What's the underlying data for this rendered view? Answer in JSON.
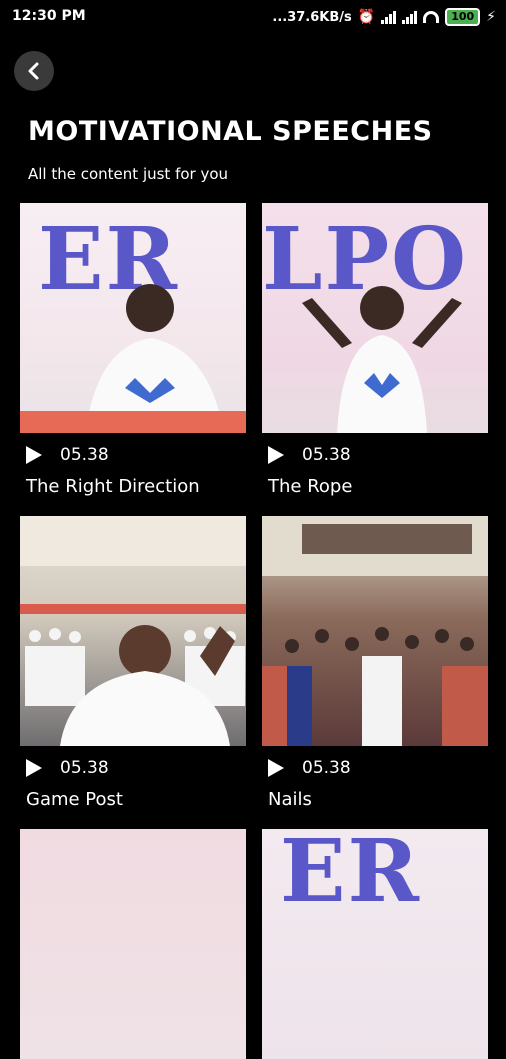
{
  "status_bar": {
    "time": "12:30 PM",
    "network_speed": "...37.6KB/s",
    "battery": "100",
    "icons": [
      "alarm-icon",
      "signal-icon",
      "signal-icon",
      "wifi-icon",
      "battery-icon",
      "charging-icon"
    ]
  },
  "header": {
    "back_icon": "chevron-left-icon",
    "title": "MOTIVATIONAL SPEECHES",
    "subtitle": "All the content just for you"
  },
  "videos": [
    {
      "duration": "05.38",
      "title": "The Right Direction",
      "thumb_text": "ER"
    },
    {
      "duration": "05.38",
      "title": "The Rope",
      "thumb_text": "LPO"
    },
    {
      "duration": "05.38",
      "title": "Game Post",
      "thumb_text": ""
    },
    {
      "duration": "05.38",
      "title": "Nails",
      "thumb_text": ""
    },
    {
      "duration": "",
      "title": "",
      "thumb_text": ""
    },
    {
      "duration": "",
      "title": "",
      "thumb_text": "ER"
    }
  ],
  "colors": {
    "background": "#000000",
    "accent_text": "#5a58c8",
    "battery": "#4caf50"
  }
}
